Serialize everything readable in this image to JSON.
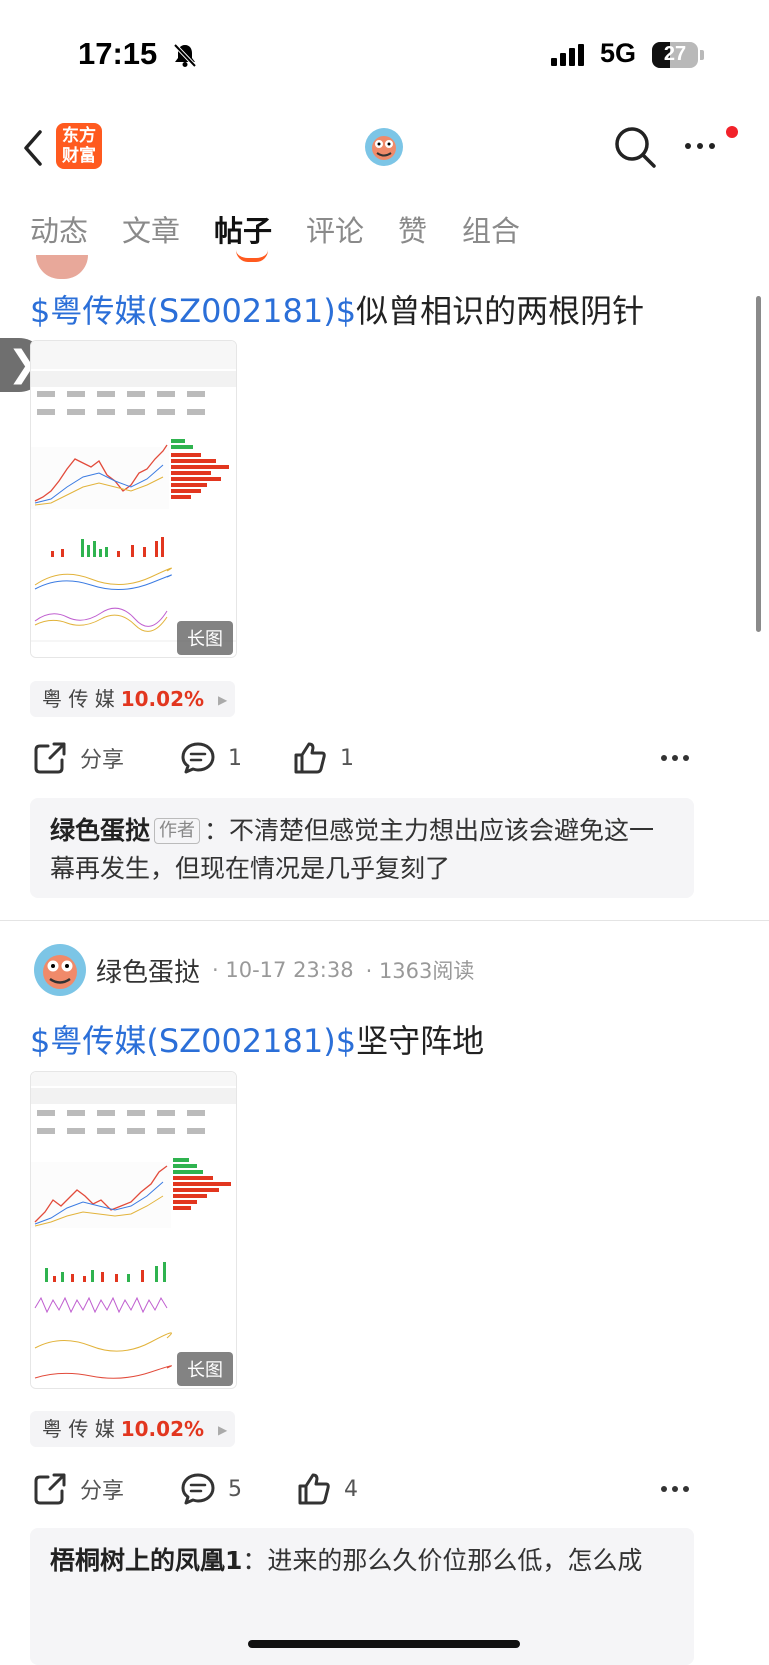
{
  "status_bar": {
    "time": "17:15",
    "network": "5G",
    "battery": "27"
  },
  "header": {
    "logo_line1": "东方",
    "logo_line2": "财富"
  },
  "tabs": [
    {
      "label": "动态"
    },
    {
      "label": "文章"
    },
    {
      "label": "帖子"
    },
    {
      "label": "评论"
    },
    {
      "label": "赞"
    },
    {
      "label": "组合"
    }
  ],
  "posts": [
    {
      "title_tag": "$粤传媒(SZ002181)$",
      "title_text": "似曾相识的两根阴针",
      "image_badge": "长图",
      "stock": {
        "name": "粤 传 媒",
        "change": "10.02%"
      },
      "share_label": "分享",
      "comment_count": "1",
      "like_count": "1",
      "comment": {
        "author": "绿色蛋挞",
        "badge": "作者",
        "text": "：不清楚但感觉主力想出应该会避免这一幕再发生，但现在情况是几乎复刻了"
      }
    },
    {
      "author": "绿色蛋挞",
      "time": "· 10-17 23:38",
      "reads": "· 1363阅读",
      "title_tag": "$粤传媒(SZ002181)$",
      "title_text": "坚守阵地",
      "image_badge": "长图",
      "stock": {
        "name": "粤 传 媒",
        "change": "10.02%"
      },
      "share_label": "分享",
      "comment_count": "5",
      "like_count": "4",
      "comment": {
        "author": "梧桐树上的凤凰1",
        "text": "：进来的那么久价位那么低，怎么成"
      }
    }
  ]
}
